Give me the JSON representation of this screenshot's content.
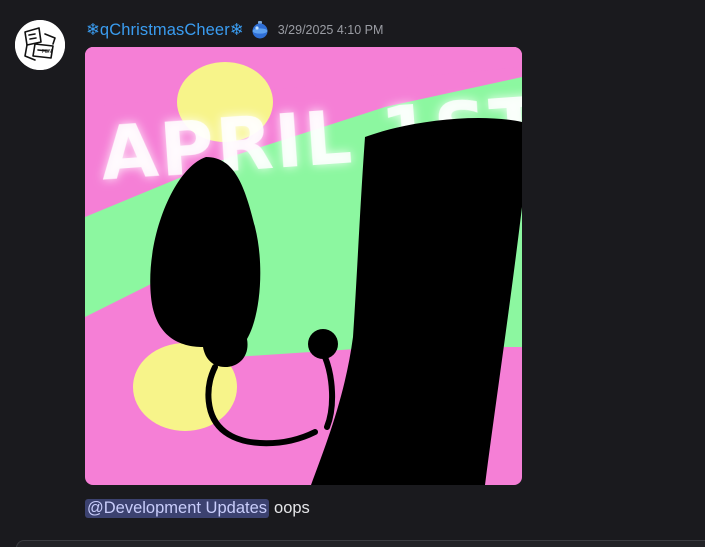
{
  "message": {
    "author": {
      "name": "❄qChristmasCheer❄",
      "role_icon": "blue-ornament-icon",
      "name_color": "#3a9cf0"
    },
    "timestamp": "3/29/2025 4:10 PM",
    "attachment": {
      "overlay_text": "APRIL 1ST",
      "colors": {
        "pink": "#f57fd6",
        "green": "#8cf7a0",
        "yellow": "#f7f48a",
        "silhouette": "#000000"
      }
    },
    "content": {
      "mention": "@Development Updates",
      "text": "oops"
    }
  },
  "theme": {
    "background": "#1a1a1e",
    "mention_bg": "#3c4270",
    "mention_fg": "#c9cdfb"
  }
}
